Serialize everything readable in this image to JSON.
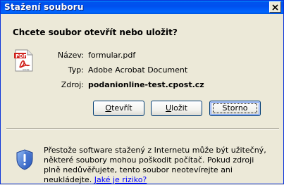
{
  "window": {
    "title": "Stažení souboru"
  },
  "dialog": {
    "question": "Chcete soubor otevřít nebo uložit?",
    "fields": {
      "name_label": "Název:",
      "name_value": "formular.pdf",
      "type_label": "Typ:",
      "type_value": "Adobe Acrobat Document",
      "source_label": "Zdroj:",
      "source_value": "podanionline-test.cpost.cz"
    },
    "buttons": {
      "open_mnemonic": "O",
      "open_rest": "tevřít",
      "save_mnemonic": "U",
      "save_rest": "ložit",
      "cancel": "Storno"
    },
    "icons": {
      "file_icon": "pdf-file-icon",
      "file_icon_text": "PDF",
      "file_icon_subtext": "Adobe",
      "warning_icon": "security-shield-icon",
      "close_icon": "close-icon"
    }
  },
  "warning": {
    "text": "Přestože software stažený z Internetu může být užitečný, některé soubory mohou poškodit počítač. Pokud zdroji plně nedůvěřujete, tento soubor neotevírejte ani neukládejte.",
    "link": "Jaké je riziko?"
  },
  "colors": {
    "titlebar": "#0054e3",
    "window_bg": "#ece9d8",
    "link": "#0000ff"
  }
}
